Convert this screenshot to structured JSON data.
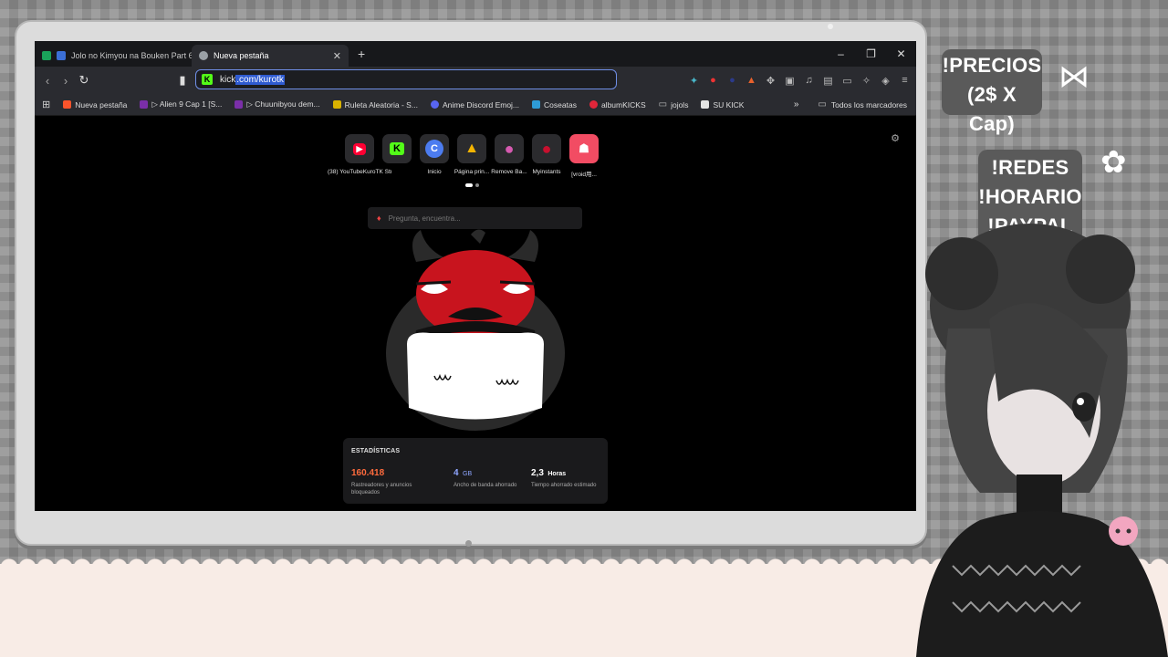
{
  "tabs": [
    {
      "label": "Jolo no Kimyou na Bouken Part 6",
      "active": false
    },
    {
      "label": "Nueva pestaña",
      "active": true
    }
  ],
  "omnibox": {
    "url_prefix": "kick",
    "url_selected": ".com/kurotk"
  },
  "bookmarks": [
    {
      "label": "Nueva pestaña",
      "color": "#fb542b"
    },
    {
      "label": "▷ Alien 9 Cap 1 [S...",
      "color": "#7a2fa8"
    },
    {
      "label": "▷ Chuunibyou dem...",
      "color": "#7a2fa8"
    },
    {
      "label": "Ruleta Aleatoria - S...",
      "color": "#d9b200"
    },
    {
      "label": "Anime Discord Emoj...",
      "color": "#5865f2"
    },
    {
      "label": "Coseatas",
      "color": "#2e9bd6"
    },
    {
      "label": "albumKICKS",
      "color": "#e0263a"
    },
    {
      "label": "jojols",
      "color": "#9a9a9a"
    },
    {
      "label": "SU KICK",
      "color": "#e4e4e4"
    }
  ],
  "bookmarks_more": "»",
  "bookmarks_all": "Todos los marcadores",
  "tiles": [
    {
      "label": "(38) YouTubeKuroTK Str...",
      "glyph": "▶",
      "bg": "#ff0033"
    },
    {
      "label": "",
      "glyph": "K",
      "bg": "#53fc18"
    },
    {
      "label": "Inicio",
      "glyph": "C",
      "bg": "#4c7cf0"
    },
    {
      "label": "Página prin...",
      "glyph": "▲",
      "bg": "#f4b400"
    },
    {
      "label": "Remove Ba...",
      "glyph": "●",
      "bg": "#d65ab0"
    },
    {
      "label": "Myinstants",
      "glyph": "●",
      "bg": "#c8102e"
    },
    {
      "label": "[vroid用...",
      "glyph": "☗",
      "bg": "#f24c63"
    }
  ],
  "search_placeholder": "Pregunta, encuentra...",
  "stats": {
    "title": "ESTADÍSTICAS",
    "items": [
      {
        "value": "160.418",
        "unit": "",
        "desc": "Rastreadores y anuncios bloqueados",
        "color": "#ff6b3d"
      },
      {
        "value": "4",
        "unit": "GB",
        "desc": "Ancho de banda ahorrado",
        "color": "#8fa6ff"
      },
      {
        "value": "2,3",
        "unit": "Horas",
        "desc": "Tiempo ahorrado estimado",
        "color": "#ffffff"
      }
    ]
  },
  "overlay": {
    "precios_line1": "!PRECIOS",
    "precios_line2": "(2$ X Cap)",
    "redes": "!REDES",
    "horario": "!HORARIO",
    "paypal": "!PAYPAL"
  }
}
